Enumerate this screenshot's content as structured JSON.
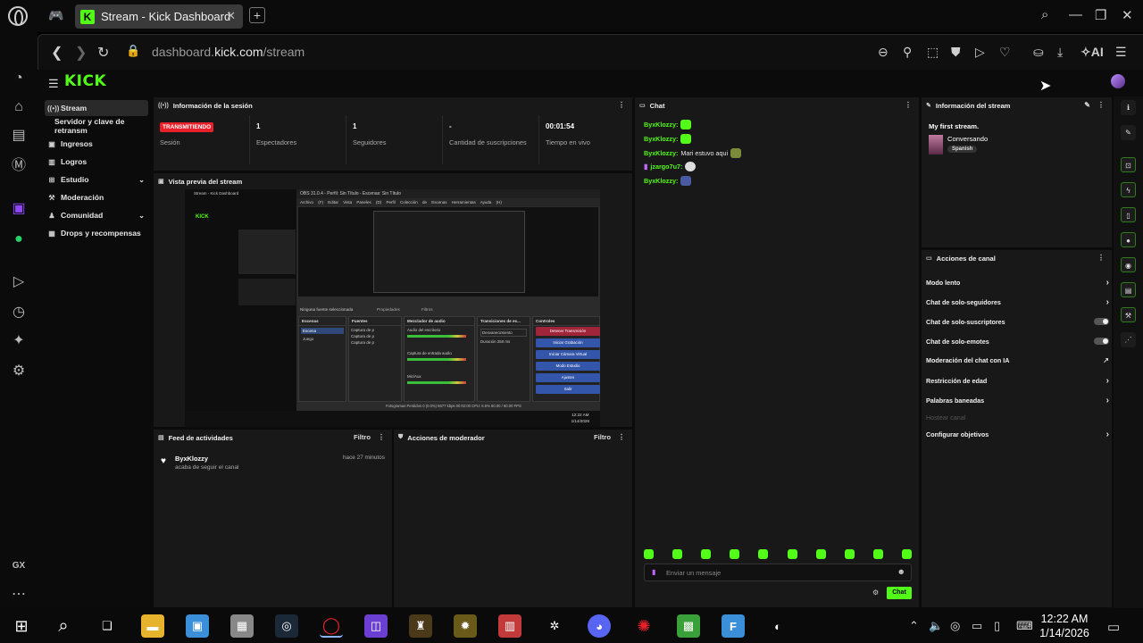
{
  "browser": {
    "tab_title": "Stream - Kick Dashboard",
    "url_prefix": "dashboard.",
    "url_domain": "kick.com",
    "url_path": "/stream",
    "ai_label": "AI",
    "gx_label": "GX"
  },
  "kick": {
    "logo": "KICK",
    "nav": {
      "stream": "Stream",
      "servidor": "Servidor y clave de retransm",
      "ingresos": "Ingresos",
      "logros": "Logros",
      "estudio": "Estudio",
      "moderacion": "Moderación",
      "comunidad": "Comunidad",
      "drops": "Drops y recompensas"
    },
    "session": {
      "title": "Información de la sesión",
      "status_badge": "TRANSMITIENDO",
      "status_label": "Sesión",
      "viewers_value": "1",
      "viewers_label": "Espectadores",
      "followers_value": "1",
      "followers_label": "Seguidores",
      "subs_value": "-",
      "subs_label": "Cantidad de suscripciones",
      "time_value": "00:01:54",
      "time_label": "Tiempo en vivo"
    },
    "preview": {
      "title": "Vista previa del stream",
      "kick_tab": "Stream - Kick Dashboard",
      "obs_title": "OBS 31.0.4 - Perfil: Sin Título - Escenas: Sin Título",
      "obs_menu": "Archivo (F)  Editar  Vista  Paneles (D)  Perfil  Colección de Escenas  Herramientas  Ayuda (H)",
      "no_source": "Ninguna fuente seleccionada",
      "props": "Propiedades",
      "filters": "Filtros",
      "docks": {
        "scenes": "Escenas",
        "sources": "Fuentes",
        "mixer": "Mezclador de audio",
        "transitions": "Transiciones de es...",
        "controls": "Controles"
      },
      "scene_items": [
        "Escena",
        "Juego"
      ],
      "source_items": [
        "Captura de p",
        "Captura de p",
        "Captura de p"
      ],
      "mixer_items": [
        "Audio del escritorio",
        "Captura de entrada audio",
        "Mic/Aux"
      ],
      "transition_value": "Desvanecimiento",
      "duration_label": "Duración",
      "duration_value": "250 ms",
      "control_buttons": [
        "Detener Transmisión",
        "Iniciar Grabación",
        "Iniciar Cámara Virtual",
        "Modo Estudio",
        "Ajustes",
        "Salir"
      ],
      "status_bar": "Fotogramas Perdidos 0 (0.0%)   6677 kbps   00:02:00   CPU: 6.5%   60.00 / 60.00 FPS",
      "clock_time": "12:22 AM",
      "clock_date": "1/14/2026"
    },
    "activity": {
      "title": "Feed de actividades",
      "filter": "Filtro",
      "user": "ByxKlozzy",
      "time": "hace 27 minutos",
      "text": "acaba de seguir el canal"
    },
    "modactions": {
      "title": "Acciones de moderador",
      "filter": "Filtro"
    },
    "chat": {
      "title": "Chat",
      "messages": [
        {
          "user": "ByxKlozzy:",
          "text": ""
        },
        {
          "user": "ByxKlozzy:",
          "text": ""
        },
        {
          "user": "ByxKlozzy:",
          "text": "Mari estuvo aqui"
        },
        {
          "user": "jzargo7u7:",
          "text": ""
        },
        {
          "user": "ByxKlozzy:",
          "text": ""
        }
      ],
      "placeholder": "Enviar un mensaje",
      "send_label": "Chat"
    },
    "stream_info": {
      "title": "Información del stream",
      "stream_title": "My first stream.",
      "category": "Conversando",
      "language": "Spanish"
    },
    "channel_actions": {
      "title": "Acciones de canal",
      "items": [
        {
          "label": "Modo lento",
          "type": "arrow"
        },
        {
          "label": "Chat de solo-seguidores",
          "type": "arrow"
        },
        {
          "label": "Chat de solo-suscriptores",
          "type": "toggle"
        },
        {
          "label": "Chat de solo-emotes",
          "type": "toggle"
        },
        {
          "label": "Moderación del chat con IA",
          "type": "external"
        },
        {
          "label": "Restricción de edad",
          "type": "arrow"
        },
        {
          "label": "Palabras baneadas",
          "type": "arrow"
        },
        {
          "label": "Hostear canal",
          "type": "disabled"
        },
        {
          "label": "Configurar objetivos",
          "type": "arrow"
        }
      ]
    }
  },
  "taskbar": {
    "time": "12:22 AM",
    "date": "1/14/2026"
  },
  "colors": {
    "kick_green": "#53fc18",
    "live_red": "#e8202a",
    "panel_bg": "#181818"
  }
}
